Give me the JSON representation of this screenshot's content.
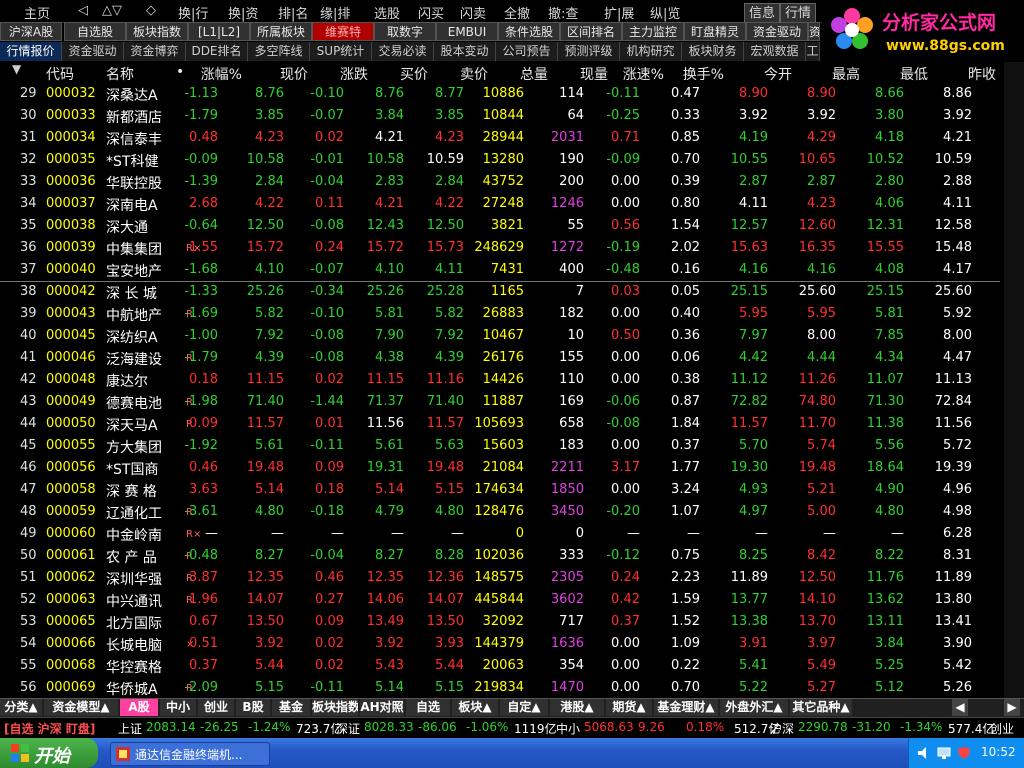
{
  "menu": {
    "items": [
      "主页",
      "◁",
      "△",
      "▽",
      "◇",
      "换|行",
      "换|资",
      "排|名",
      "缘|排",
      "选股",
      "闪买",
      "闪卖",
      "全撤",
      "撤:查",
      "扩|展",
      "纵|览"
    ],
    "info": "信息",
    "market": "行情"
  },
  "logo": {
    "title": "分析家公式网",
    "url": "www.88gs.com"
  },
  "tabs1": [
    "沪深A股",
    "自选股",
    "板块指数",
    "[L1|L2]",
    "所属板块",
    "维赛特",
    "取数字",
    "EMBUI",
    "条件选股",
    "区间排名",
    "主力监控",
    "盯盘精灵",
    "资金驱动",
    "资"
  ],
  "tabs2": [
    "行情报价",
    "资金驱动",
    "资金博弈",
    "DDE排名",
    "多空阵线",
    "SUP统计",
    "交易必读",
    "股本变动",
    "公司预告",
    "预测评级",
    "机构研究",
    "板块财务",
    "宏观数据",
    "工"
  ],
  "header": [
    "代码",
    "名称",
    "•",
    "涨幅%",
    "现价",
    "涨跌",
    "买价",
    "卖价",
    "总量",
    "现量",
    "涨速%",
    "换手%",
    "今开",
    "最高",
    "最低",
    "昨收"
  ],
  "colors": {
    "up": "#ff3030",
    "down": "#30d030",
    "flat": "#ffffff",
    "code": "#ffff00",
    "vol": "#ffff00",
    "magenta": "#e040e0",
    "rank": "#e0e0e0"
  },
  "rows": [
    [
      "29",
      "000032",
      "深桑达A",
      "",
      "-1.13",
      "8.76",
      "-0.10",
      "8.76",
      "8.77",
      "10886",
      "114",
      "-0.11",
      "0.47",
      "8.90",
      "8.90",
      "8.66",
      "8.86"
    ],
    [
      "30",
      "000033",
      "新都酒店",
      "",
      "-1.79",
      "3.85",
      "-0.07",
      "3.84",
      "3.85",
      "10844",
      "64",
      "-0.25",
      "0.33",
      "3.92",
      "3.92",
      "3.80",
      "3.92"
    ],
    [
      "31",
      "000034",
      "深信泰丰",
      "",
      "0.48",
      "4.23",
      "0.02",
      "4.21",
      "4.23",
      "28944",
      "2031",
      "0.71",
      "0.85",
      "4.19",
      "4.29",
      "4.18",
      "4.21"
    ],
    [
      "32",
      "000035",
      "*ST科健",
      "",
      "-0.09",
      "10.58",
      "-0.01",
      "10.58",
      "10.59",
      "13280",
      "190",
      "-0.09",
      "0.70",
      "10.55",
      "10.65",
      "10.52",
      "10.59"
    ],
    [
      "33",
      "000036",
      "华联控股",
      "",
      "-1.39",
      "2.84",
      "-0.04",
      "2.83",
      "2.84",
      "43752",
      "200",
      "0.00",
      "0.39",
      "2.87",
      "2.87",
      "2.80",
      "2.88"
    ],
    [
      "34",
      "000037",
      "深南电A",
      "",
      "2.68",
      "4.22",
      "0.11",
      "4.21",
      "4.22",
      "27248",
      "1246",
      "0.00",
      "0.80",
      "4.11",
      "4.23",
      "4.06",
      "4.11"
    ],
    [
      "35",
      "000038",
      "深大通",
      "",
      "-0.64",
      "12.50",
      "-0.08",
      "12.43",
      "12.50",
      "3821",
      "55",
      "0.56",
      "1.54",
      "12.57",
      "12.60",
      "12.31",
      "12.58"
    ],
    [
      "36",
      "000039",
      "中集集团",
      "R×",
      "1.55",
      "15.72",
      "0.24",
      "15.72",
      "15.73",
      "248629",
      "1272",
      "-0.19",
      "2.02",
      "15.63",
      "16.35",
      "15.55",
      "15.48"
    ],
    [
      "37",
      "000040",
      "宝安地产",
      "",
      "-1.68",
      "4.10",
      "-0.07",
      "4.10",
      "4.11",
      "7431",
      "400",
      "-0.48",
      "0.16",
      "4.16",
      "4.16",
      "4.08",
      "4.17"
    ],
    [
      "38",
      "000042",
      "深 长 城",
      "",
      "-1.33",
      "25.26",
      "-0.34",
      "25.26",
      "25.28",
      "1165",
      "7",
      "0.03",
      "0.05",
      "25.15",
      "25.60",
      "25.15",
      "25.60"
    ],
    [
      "39",
      "000043",
      "中航地产",
      "R",
      "-1.69",
      "5.82",
      "-0.10",
      "5.81",
      "5.82",
      "26883",
      "182",
      "0.00",
      "0.40",
      "5.95",
      "5.95",
      "5.81",
      "5.92"
    ],
    [
      "40",
      "000045",
      "深纺织A",
      "",
      "-1.00",
      "7.92",
      "-0.08",
      "7.90",
      "7.92",
      "10467",
      "10",
      "0.50",
      "0.36",
      "7.97",
      "8.00",
      "7.85",
      "8.00"
    ],
    [
      "41",
      "000046",
      "泛海建设",
      "R",
      "-1.79",
      "4.39",
      "-0.08",
      "4.38",
      "4.39",
      "26176",
      "155",
      "0.00",
      "0.06",
      "4.42",
      "4.44",
      "4.34",
      "4.47"
    ],
    [
      "42",
      "000048",
      "康达尔",
      "",
      "0.18",
      "11.15",
      "0.02",
      "11.15",
      "11.16",
      "14426",
      "110",
      "0.00",
      "0.38",
      "11.12",
      "11.26",
      "11.07",
      "11.13"
    ],
    [
      "43",
      "000049",
      "德赛电池",
      "R",
      "-1.98",
      "71.40",
      "-1.44",
      "71.37",
      "71.40",
      "11887",
      "169",
      "-0.06",
      "0.87",
      "72.82",
      "74.80",
      "71.30",
      "72.84"
    ],
    [
      "44",
      "000050",
      "深天马A",
      "R",
      "0.09",
      "11.57",
      "0.01",
      "11.56",
      "11.57",
      "105693",
      "658",
      "-0.08",
      "1.84",
      "11.57",
      "11.70",
      "11.38",
      "11.56"
    ],
    [
      "45",
      "000055",
      "方大集团",
      "",
      "-1.92",
      "5.61",
      "-0.11",
      "5.61",
      "5.63",
      "15603",
      "183",
      "0.00",
      "0.37",
      "5.70",
      "5.74",
      "5.56",
      "5.72"
    ],
    [
      "46",
      "000056",
      "*ST国商",
      "",
      "0.46",
      "19.48",
      "0.09",
      "19.31",
      "19.48",
      "21084",
      "2211",
      "3.17",
      "1.77",
      "19.30",
      "19.48",
      "18.64",
      "19.39"
    ],
    [
      "47",
      "000058",
      "深 赛 格",
      "",
      "3.63",
      "5.14",
      "0.18",
      "5.14",
      "5.15",
      "174634",
      "1850",
      "0.00",
      "3.24",
      "4.93",
      "5.21",
      "4.90",
      "4.96"
    ],
    [
      "48",
      "000059",
      "辽通化工",
      "R",
      "-3.61",
      "4.80",
      "-0.18",
      "4.79",
      "4.80",
      "128476",
      "3450",
      "-0.20",
      "1.07",
      "4.97",
      "5.00",
      "4.80",
      "4.98"
    ],
    [
      "49",
      "000060",
      "中金岭南",
      "R×",
      "—",
      "—",
      "—",
      "—",
      "—",
      "0",
      "0",
      "—",
      "—",
      "—",
      "—",
      "—",
      "6.28"
    ],
    [
      "50",
      "000061",
      "农 产 品",
      "R",
      "-0.48",
      "8.27",
      "-0.04",
      "8.27",
      "8.28",
      "102036",
      "333",
      "-0.12",
      "0.75",
      "8.25",
      "8.42",
      "8.22",
      "8.31"
    ],
    [
      "51",
      "000062",
      "深圳华强",
      "R",
      "3.87",
      "12.35",
      "0.46",
      "12.35",
      "12.36",
      "148575",
      "2305",
      "0.24",
      "2.23",
      "11.89",
      "12.50",
      "11.76",
      "11.89"
    ],
    [
      "52",
      "000063",
      "中兴通讯",
      "R",
      "1.96",
      "14.07",
      "0.27",
      "14.06",
      "14.07",
      "445844",
      "3602",
      "0.42",
      "1.59",
      "13.77",
      "14.10",
      "13.62",
      "13.80"
    ],
    [
      "53",
      "000065",
      "北方国际",
      "",
      "0.67",
      "13.50",
      "0.09",
      "13.49",
      "13.50",
      "32092",
      "717",
      "0.37",
      "1.52",
      "13.38",
      "13.70",
      "13.11",
      "13.41"
    ],
    [
      "54",
      "000066",
      "长城电脑",
      "×",
      "0.51",
      "3.92",
      "0.02",
      "3.92",
      "3.93",
      "144379",
      "1636",
      "0.00",
      "1.09",
      "3.91",
      "3.97",
      "3.84",
      "3.90"
    ],
    [
      "55",
      "000068",
      "华控赛格",
      "",
      "0.37",
      "5.44",
      "0.02",
      "5.43",
      "5.44",
      "20063",
      "354",
      "0.00",
      "0.22",
      "5.41",
      "5.49",
      "5.25",
      "5.42"
    ],
    [
      "56",
      "000069",
      "华侨城A",
      "R",
      "-2.09",
      "5.15",
      "-0.11",
      "5.14",
      "5.15",
      "219834",
      "1470",
      "0.00",
      "0.70",
      "5.22",
      "5.27",
      "5.12",
      "5.26"
    ]
  ],
  "bottom_tabs": [
    "分类▲",
    "资金模型▲",
    "A股",
    "中小",
    "创业",
    "B股",
    "基金",
    "板块指数",
    "AH对照",
    "自选",
    "板块▲",
    "自定▲",
    "港股▲",
    "期货▲",
    "基金理财▲",
    "外盘外汇▲",
    "其它品种▲"
  ],
  "ticker": {
    "prefix": "[自选 沪深 盯盘]",
    "items": [
      {
        "label": "上证",
        "value": "2083.14",
        "change": "-26.25",
        "pct": "-1.24%",
        "amount": "723.7亿"
      },
      {
        "label": "深证",
        "value": "8028.33",
        "change": "-86.06",
        "pct": "-1.06%",
        "amount": "1119亿"
      },
      {
        "label": "中小",
        "value": "5068.63",
        "change": "9.26",
        "pct": "0.18%",
        "amount": "512.7亿"
      },
      {
        "label": "沪深",
        "value": "2290.78",
        "change": "-31.20",
        "pct": "-1.34%",
        "amount": "577.4亿"
      }
    ],
    "tail": "创业"
  },
  "taskbar": {
    "start": "开始",
    "task": "通达信金融终端机...",
    "time": "10:52"
  }
}
